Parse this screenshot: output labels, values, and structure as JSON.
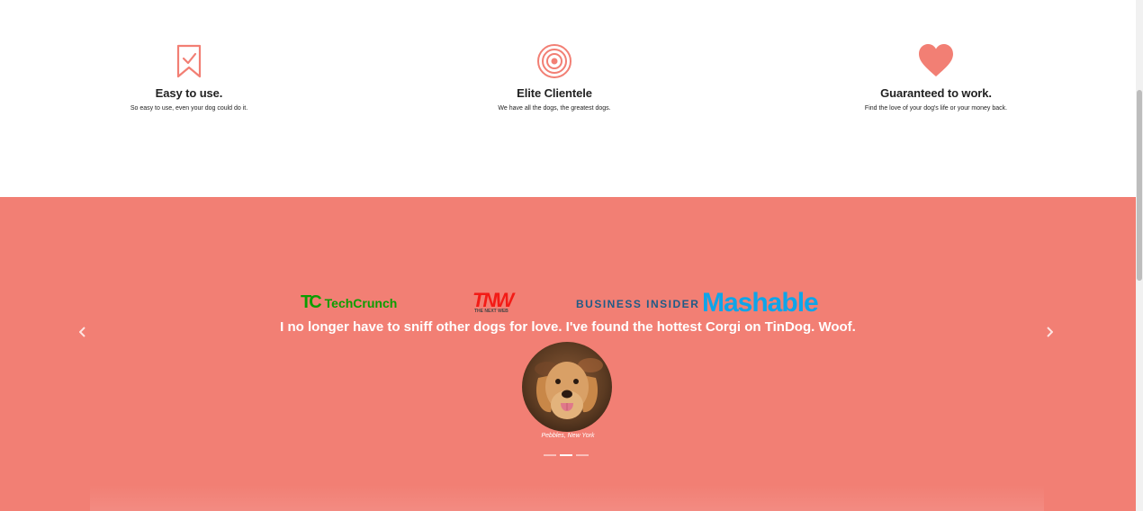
{
  "colors": {
    "accent": "#f27f74",
    "heading": "#222222",
    "white": "#ffffff"
  },
  "features": [
    {
      "icon": "bookmark-check-icon",
      "title": "Easy to use.",
      "text": "So easy to use, even your dog could do it."
    },
    {
      "icon": "target-icon",
      "title": "Elite Clientele",
      "text": "We have all the dogs, the greatest dogs."
    },
    {
      "icon": "heart-icon",
      "title": "Guaranteed to work.",
      "text": "Find the love of your dog's life or your money back."
    }
  ],
  "testimonial": {
    "quote": "I no longer have to sniff other dogs for love. I've found the hottest Corgi on TinDog. Woof.",
    "caption": "Pebbles, New York",
    "slide_count": 3,
    "active_slide": 2,
    "prev_icon": "chevron-left-icon",
    "next_icon": "chevron-right-icon"
  },
  "press": {
    "techcrunch": {
      "mark": "TC",
      "name": "TechCrunch"
    },
    "tnw": {
      "name": "TNW",
      "sub": "THE NEXT WEB"
    },
    "business_insider": "BUSINESS INSIDER",
    "mashable": "Mashable"
  }
}
